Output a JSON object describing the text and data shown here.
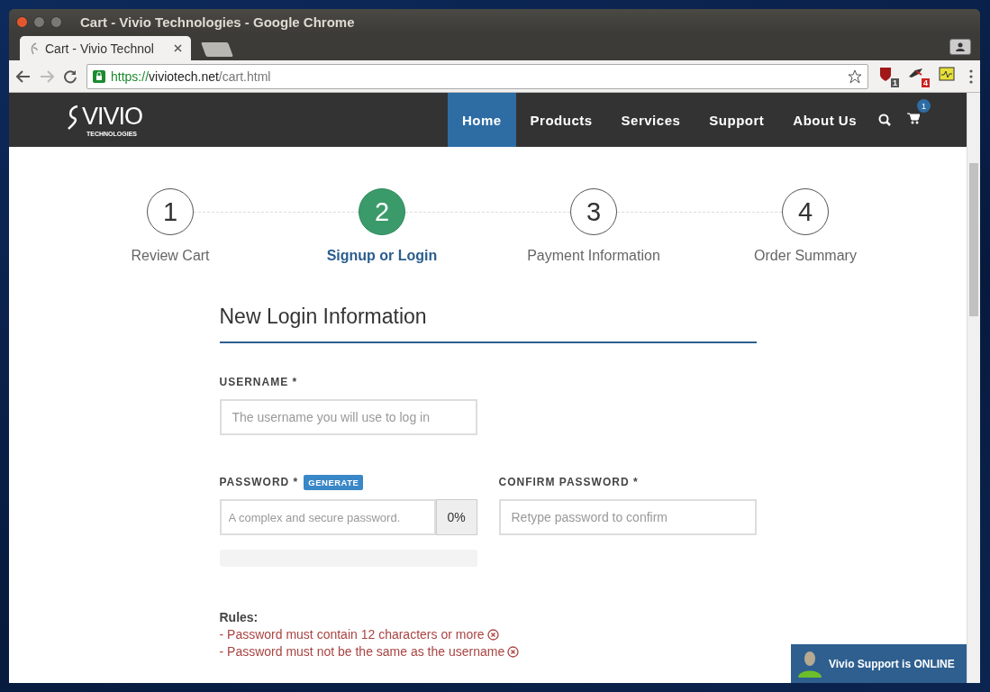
{
  "window": {
    "title": "Cart - Vivio Technologies - Google Chrome"
  },
  "tabs": [
    {
      "label": "Cart - Vivio Technol",
      "selected": true
    }
  ],
  "address_bar": {
    "scheme": "https://",
    "host": "viviotech.net",
    "path": "/cart.html"
  },
  "extensions": [
    {
      "kind": "shield",
      "badge": "1"
    },
    {
      "kind": "bird",
      "badge": "4"
    },
    {
      "kind": "monitor"
    }
  ],
  "site_nav": {
    "logo": "VIVIO",
    "logo_sub": "TECHNOLOGIES",
    "items": [
      {
        "label": "Home",
        "selected": true
      },
      {
        "label": "Products",
        "selected": false
      },
      {
        "label": "Services",
        "selected": false
      },
      {
        "label": "Support",
        "selected": false
      },
      {
        "label": "About Us",
        "selected": false
      }
    ],
    "cart_count": "1"
  },
  "steps": [
    {
      "number": "1",
      "label": "Review Cart",
      "selected": false
    },
    {
      "number": "2",
      "label": "Signup or Login",
      "selected": true
    },
    {
      "number": "3",
      "label": "Payment Information",
      "selected": false
    },
    {
      "number": "4",
      "label": "Order Summary",
      "selected": false
    }
  ],
  "form": {
    "heading": "New Login Information",
    "username": {
      "label": "USERNAME",
      "required": "*",
      "placeholder": "The username you will use to log in"
    },
    "password": {
      "label": "PASSWORD",
      "required": "*",
      "generate": "GENERATE",
      "placeholder": "A complex and secure password.",
      "strength": "0%",
      "level": 0
    },
    "confirm": {
      "label": "CONFIRM PASSWORD",
      "required": "*",
      "placeholder": "Retype password to confirm"
    },
    "rules_title": "Rules:",
    "rules": [
      {
        "text": "- Password must contain 12 characters or more",
        "met": false
      },
      {
        "text": "- Password must not be the same as the username",
        "met": false
      }
    ]
  },
  "chat": {
    "label": "Vivio Support is ONLINE"
  }
}
